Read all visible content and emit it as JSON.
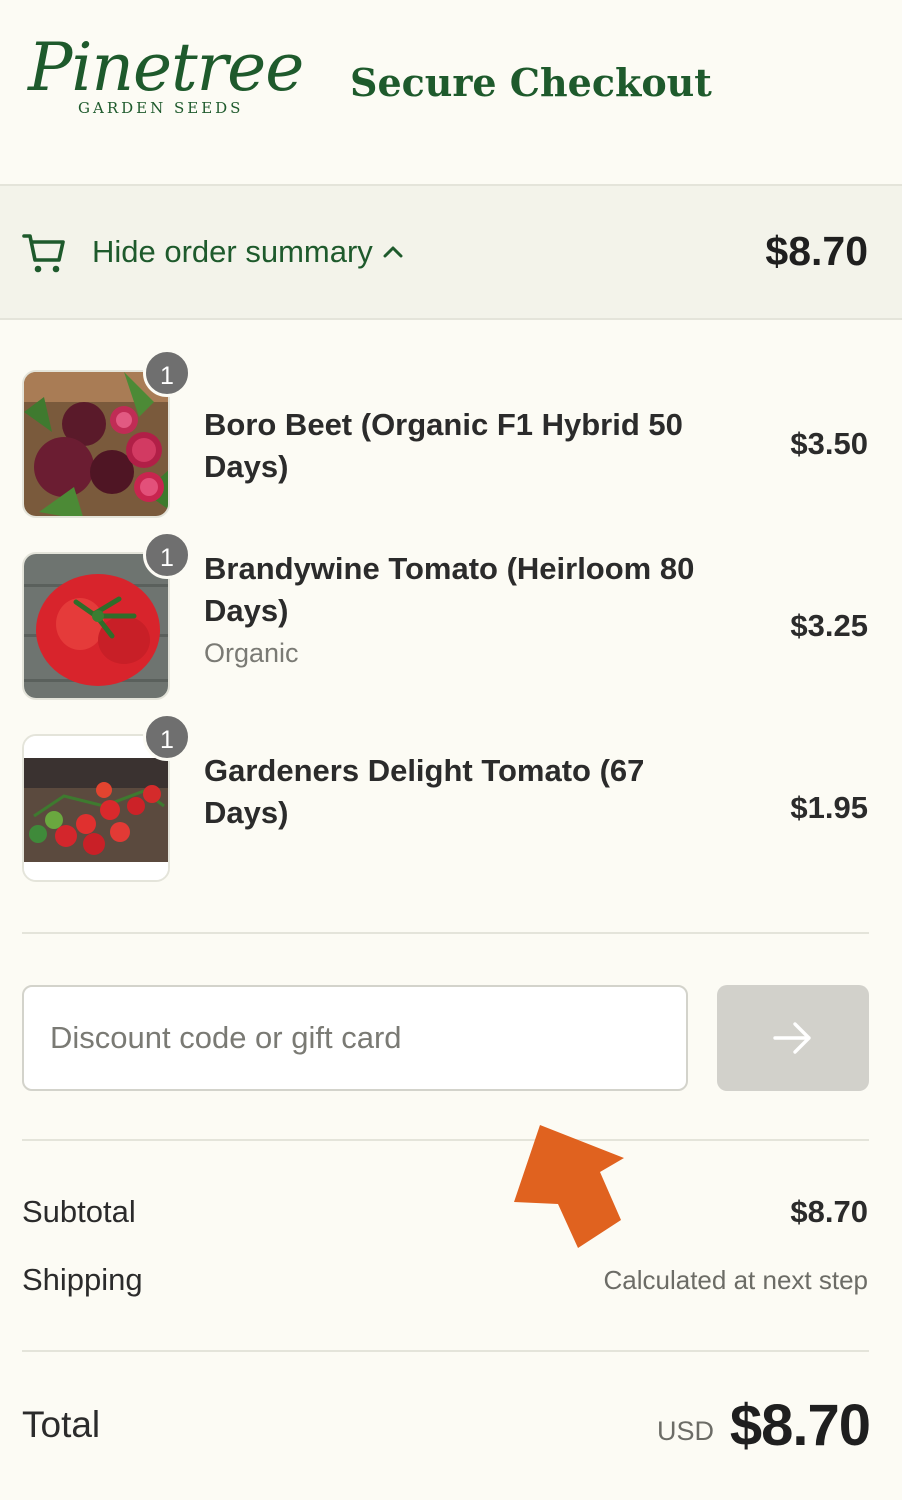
{
  "header": {
    "logo_script": "Pinetree",
    "logo_subtitle": "GARDEN SEEDS",
    "title": "Secure Checkout"
  },
  "summary_bar": {
    "toggle_label": "Hide order summary",
    "total": "$8.70",
    "icon": "cart-icon"
  },
  "items": [
    {
      "quantity": "1",
      "name": "Boro Beet (Organic F1 Hybrid 50 Days)",
      "variant": "",
      "price": "$3.50"
    },
    {
      "quantity": "1",
      "name": "Brandywine Tomato (Heirloom 80 Days)",
      "variant": "Organic",
      "price": "$3.25"
    },
    {
      "quantity": "1",
      "name": "Gardeners Delight Tomato (67 Days)",
      "variant": "",
      "price": "$1.95"
    }
  ],
  "discount": {
    "placeholder": "Discount code or gift card",
    "value": "",
    "apply_icon": "arrow-right-icon"
  },
  "totals": {
    "subtotal_label": "Subtotal",
    "subtotal_value": "$8.70",
    "shipping_label": "Shipping",
    "shipping_value": "Calculated at next step",
    "total_label": "Total",
    "currency": "USD",
    "total_value": "$8.70"
  },
  "colors": {
    "brand_green": "#1e5a2c",
    "background": "#fcfbf4",
    "summary_bar": "#f3f3ea",
    "annotation_arrow": "#e0621f",
    "apply_button": "#d2d1cb"
  }
}
